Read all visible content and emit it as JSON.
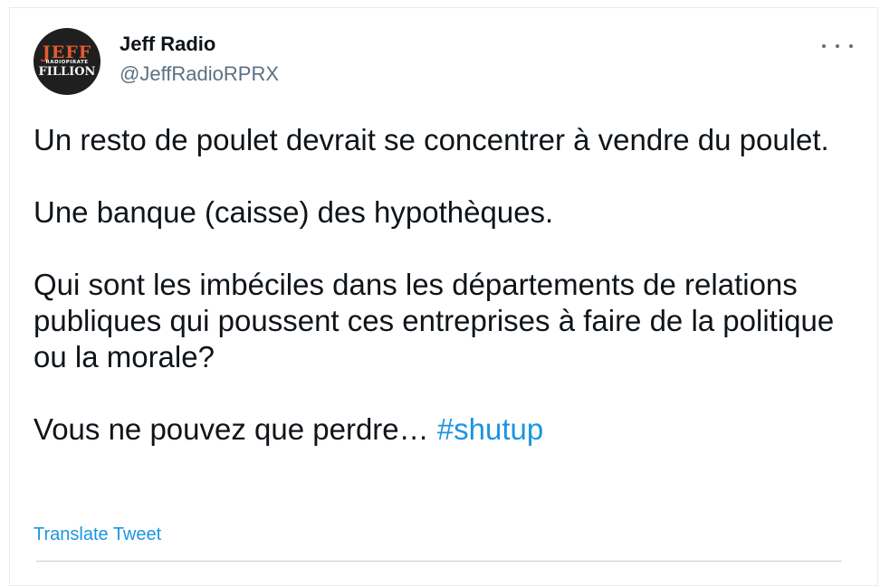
{
  "tweet": {
    "author_name": "Jeff Radio",
    "author_handle": "@JeffRadioRPRX",
    "avatar": {
      "line1": "JEFF",
      "line2": "RADIOPIRATE",
      "line3": "FILLION"
    },
    "more_icon": "more-dots-icon",
    "paragraphs": [
      "Un resto de poulet devrait se concentrer à vendre du poulet.",
      "Une banque (caisse) des hypothèques.",
      "Qui sont les imbéciles dans les départements de relations publiques qui poussent ces entreprises à faire de la politique ou la morale?"
    ],
    "last_line_text": "Vous ne pouvez que perdre… ",
    "hashtag": "#shutup",
    "translate_label": "Translate Tweet"
  },
  "colors": {
    "text": "#0f1419",
    "secondary": "#5b7083",
    "link": "#1b95e0",
    "avatar_accent": "#e35b2f"
  }
}
